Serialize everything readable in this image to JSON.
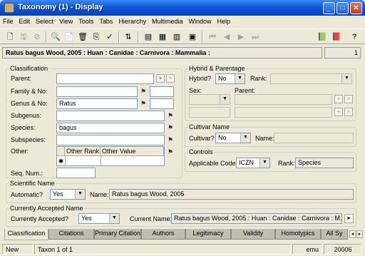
{
  "window": {
    "title": "Taxonomy (1) - Display"
  },
  "menu": [
    "File",
    "Edit",
    "Select",
    "View",
    "Tools",
    "Tabs",
    "Hierarchy",
    "Multimedia",
    "Window",
    "Help"
  ],
  "header": {
    "summary": "Ratus bagus Wood, 2005 : Huan : Canidae : Carnivora : Mammalia :",
    "record_number": "1"
  },
  "classification": {
    "legend": "Classification",
    "parent_label": "Parent:",
    "parent_value": "",
    "family_label": "Family & No:",
    "family_value": "",
    "genus_label": "Genus & No:",
    "genus_value": "Ratus",
    "subgenus_label": "Subgenus:",
    "subgenus_value": "",
    "species_label": "Species:",
    "species_value": "bagus",
    "subspecies_label": "Subspecies:",
    "subspecies_value": "",
    "other_label": "Other:",
    "other_columns": [
      "Other Rank",
      "Other Value"
    ],
    "seq_label": "Seq. Num.:",
    "seq_value": ""
  },
  "hybrid": {
    "legend": "Hybrid & Parentage",
    "hybrid_label": "Hybrid?",
    "hybrid_value": "No",
    "rank_label": "Rank:",
    "rank_value": "",
    "sex_label": "Sex:",
    "parent_label": "Parent:"
  },
  "cultivar": {
    "legend": "Cultivar Name",
    "cultivar_label": "Cultivar?",
    "cultivar_value": "No",
    "name_label": "Name:",
    "name_value": ""
  },
  "controls": {
    "legend": "Controls",
    "code_label": "Applicable Code:",
    "code_value": "ICZN",
    "rank_label": "Rank:",
    "rank_value": "Species"
  },
  "scientific": {
    "legend": "Scientific Name",
    "auto_label": "Automatic?",
    "auto_value": "Yes",
    "name_label": "Name:",
    "name_value": "Ratus bagus Wood, 2005"
  },
  "accepted": {
    "legend": "Currently Accepted Name",
    "accepted_label": "Currently Accepted?",
    "accepted_value": "Yes",
    "current_label": "Current Name:",
    "current_value": "Ratus bagus Wood, 2005 : Huan : Canidae : Carnivora : M..."
  },
  "tabs": [
    "Classification",
    "Citations",
    "Primary Citation",
    "Authors",
    "Legitimacy",
    "Validity",
    "Homotypics",
    "All Sy"
  ],
  "status": {
    "mode": "New",
    "position": "Taxon 1 of 1",
    "user": "emu",
    "record": "20006"
  }
}
